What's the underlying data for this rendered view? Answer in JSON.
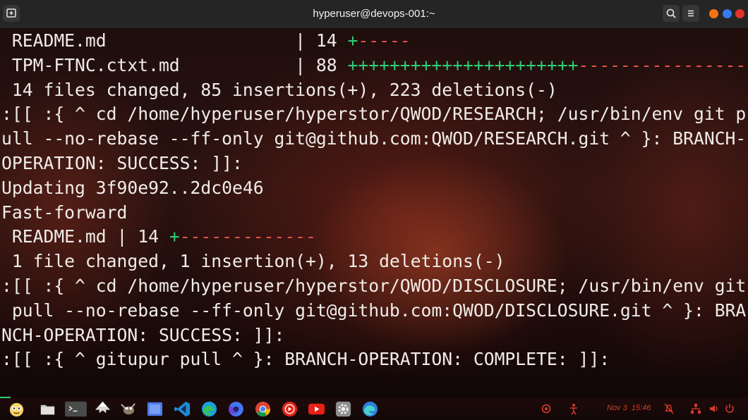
{
  "window": {
    "title": "hyperuser@devops-001:~",
    "controls": {
      "new_tab_icon": "terminal-new-tab-icon",
      "search_icon": "search-icon",
      "menu_icon": "hamburger-menu-icon",
      "dot_colors": [
        "#f2730f",
        "#3a78f0",
        "#e5322b"
      ]
    }
  },
  "terminal": {
    "colors": {
      "text": "#f0ece8",
      "insert": "#2ecc71",
      "delete": "#e8524a"
    },
    "lines": [
      {
        "t": " README.md                  | 14 ",
        "p": "+",
        "m": "-----"
      },
      {
        "t": " TPM-FTNC.ctxt.md           | 88 ",
        "p": "++++++++++++++++++++++",
        "m": "-------------------------"
      },
      {
        "t": " 14 files changed, 85 insertions(+), 223 deletions(-)"
      },
      {
        "t": ":[[ :{ ^ cd /home/hyperuser/hyperstor/QWOD/RESEARCH; /usr/bin/env git p"
      },
      {
        "t": "ull --no-rebase --ff-only git@github.com:QWOD/RESEARCH.git ^ }: BRANCH-"
      },
      {
        "t": "OPERATION: SUCCESS: ]]:"
      },
      {
        "t": "Updating 3f90e92..2dc0e46"
      },
      {
        "t": "Fast-forward"
      },
      {
        "t": " README.md | 14 ",
        "p": "+",
        "m": "-------------"
      },
      {
        "t": " 1 file changed, 1 insertion(+), 13 deletions(-)"
      },
      {
        "t": ":[[ :{ ^ cd /home/hyperuser/hyperstor/QWOD/DISCLOSURE; /usr/bin/env git"
      },
      {
        "t": " pull --no-rebase --ff-only git@github.com:QWOD/DISCLOSURE.git ^ }: BRA"
      },
      {
        "t": "NCH-OPERATION: SUCCESS: ]]:"
      },
      {
        "t": ":[[ :{ ^ gitupur pull ^ }: BRANCH-OPERATION: COMPLETE: ]]:"
      }
    ]
  },
  "taskbar": {
    "apps": [
      "app-launcher-icon",
      "files-icon",
      "terminal-icon",
      "inkscape-icon",
      "gimp-icon",
      "workspace-icon",
      "vscode-icon",
      "edge-icon",
      "firefox-icon",
      "chrome-icon",
      "youtube-music-icon",
      "youtube-icon",
      "settings-icon",
      "edge-dev-icon"
    ],
    "tray": {
      "clock": "Nov 3  15:46",
      "accent": "#d83a2c",
      "icons": [
        "network-icon",
        "accessibility-icon",
        "notifications-muted-icon",
        "network-wired-icon",
        "volume-icon",
        "power-icon"
      ]
    }
  }
}
